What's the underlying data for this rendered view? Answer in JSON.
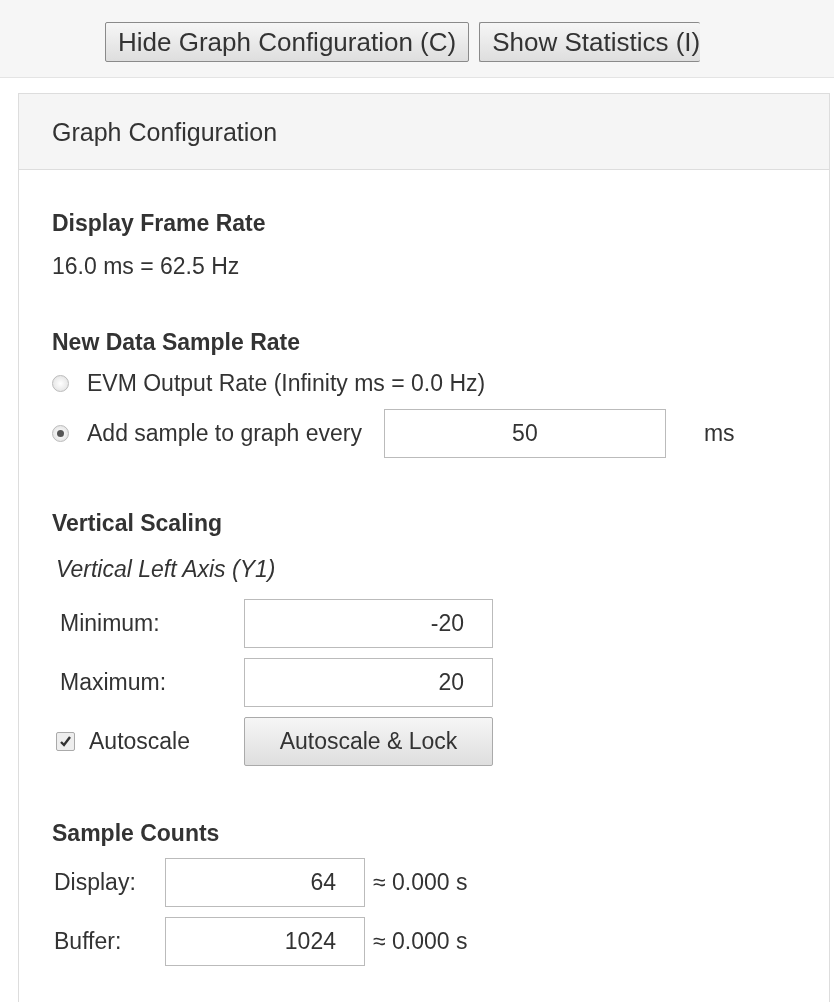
{
  "toolbar": {
    "buttons": [
      {
        "label": "Hide Graph Configuration (C)"
      },
      {
        "label": "Show Statistics (I)"
      }
    ]
  },
  "panel": {
    "title": "Graph Configuration",
    "frame_rate": {
      "heading": "Display Frame Rate",
      "value": "16.0 ms = 62.5 Hz"
    },
    "sample_rate": {
      "heading": "New Data Sample Rate",
      "options": [
        {
          "label": "EVM Output Rate (Infinity ms = 0.0 Hz)",
          "selected": false
        },
        {
          "label": "Add sample to graph every",
          "selected": true
        }
      ],
      "interval": {
        "value": "50",
        "unit": "ms"
      }
    },
    "vertical_scaling": {
      "heading": "Vertical Scaling",
      "axis_label": "Vertical Left Axis (Y1)",
      "fields": [
        {
          "label": "Minimum:",
          "value": "-20"
        },
        {
          "label": "Maximum:",
          "value": "20"
        }
      ],
      "autoscale": {
        "label": "Autoscale",
        "checked": true
      },
      "lock_button": "Autoscale & Lock"
    },
    "sample_counts": {
      "heading": "Sample Counts",
      "rows": [
        {
          "label": "Display:",
          "value": "64",
          "duration": "≈ 0.000 s"
        },
        {
          "label": "Buffer:",
          "value": "1024",
          "duration": "≈ 0.000 s"
        }
      ]
    }
  }
}
